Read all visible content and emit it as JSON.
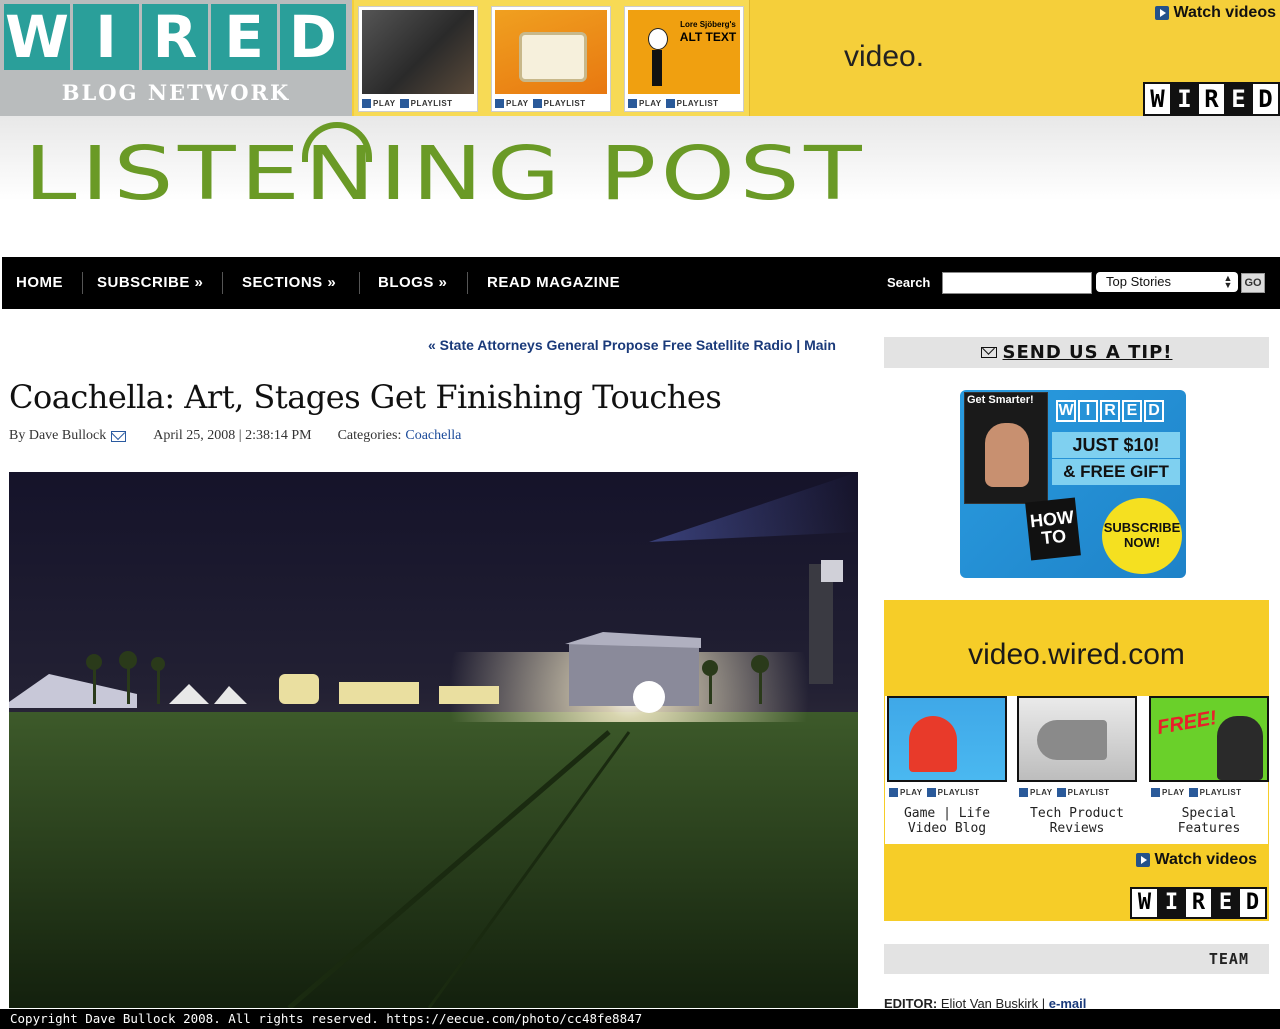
{
  "network": {
    "logo_letters": [
      "W",
      "I",
      "R",
      "E",
      "D"
    ],
    "subtitle": "BLOG NETWORK"
  },
  "top_ad": {
    "thumbs": [
      {
        "play": "PLAY",
        "playlist": "PLAYLIST"
      },
      {
        "play": "PLAY",
        "playlist": "PLAYLIST"
      },
      {
        "play": "PLAY",
        "playlist": "PLAYLIST",
        "title_small": "Lore Sjöberg's",
        "title": "ALT TEXT"
      }
    ],
    "video_word": "video.",
    "watch_label": "Watch videos",
    "brand_letters": [
      "W",
      "I",
      "R",
      "E",
      "D"
    ]
  },
  "site": {
    "title": "LISTENING POST"
  },
  "nav": {
    "items": [
      "HOME",
      "SUBSCRIBE »",
      "SECTIONS »",
      "BLOGS »",
      "READ MAGAZINE"
    ],
    "search_label": "Search",
    "search_value": "",
    "select_value": "Top Stories",
    "go_label": "GO"
  },
  "article": {
    "prev_link": "« State Attorneys General Propose Free Satellite Radio",
    "divider": "|",
    "main_link": "Main",
    "title": "Coachella: Art, Stages Get Finishing Touches",
    "byline_prefix": "By Dave Bullock",
    "date": "April 25, 2008 | 2:38:14 PM",
    "categories_label": "Categories:",
    "category": "Coachella"
  },
  "sidebar": {
    "tip_label": "SEND US A TIP!",
    "subscribe_ad": {
      "get_smarter": "Get Smarter!",
      "brand_letters": [
        "W",
        "I",
        "R",
        "E",
        "D"
      ],
      "price": "JUST $10!",
      "gift": "& FREE GIFT",
      "howto": "HOW TO",
      "cta": "SUBSCRIBE NOW!"
    },
    "video_promo": {
      "heading": "video.wired.com",
      "items": [
        {
          "caption_line1": "Game | Life",
          "caption_line2": "Video Blog",
          "play": "PLAY",
          "playlist": "PLAYLIST"
        },
        {
          "caption_line1": "Tech Product",
          "caption_line2": "Reviews",
          "play": "PLAY",
          "playlist": "PLAYLIST"
        },
        {
          "caption_line1": "Special",
          "caption_line2": "Features",
          "play": "PLAY",
          "playlist": "PLAYLIST",
          "free": "FREE!"
        }
      ],
      "watch_label": "Watch videos",
      "brand_letters": [
        "W",
        "I",
        "R",
        "E",
        "D"
      ]
    },
    "team_label": "TEAM",
    "editor_label": "EDITOR:",
    "editor_name": "Eliot Van Buskirk",
    "editor_divider": "|",
    "editor_email": "e-mail"
  },
  "footer": {
    "copyright": "Copyright Dave Bullock 2008. All rights reserved. https://eecue.com/photo/cc48fe8847"
  },
  "colors": {
    "wired_teal": "#2a9f9a",
    "listening_post_green": "#6a9a26",
    "video_yellow": "#f6cd28",
    "link_blue": "#1a3a7a",
    "nav_black": "#000000"
  }
}
